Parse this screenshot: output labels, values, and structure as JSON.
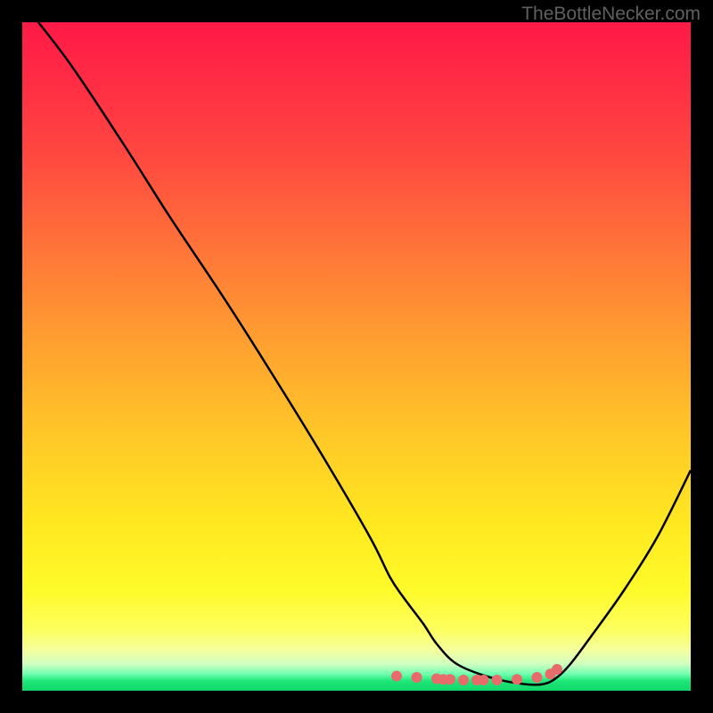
{
  "watermark": "TheBottleNecker.com",
  "chart_data": {
    "type": "line",
    "title": "",
    "xlabel": "",
    "ylabel": "",
    "xlim": [
      0,
      100
    ],
    "ylim": [
      0,
      100
    ],
    "series": [
      {
        "name": "bottleneck-curve",
        "x": [
          0,
          7,
          15,
          22,
          30,
          37,
          45,
          52,
          55,
          57,
          60,
          62,
          65,
          70,
          75,
          78,
          80,
          82,
          85,
          90,
          95,
          100
        ],
        "values": [
          103,
          94,
          82,
          71,
          59,
          48,
          35,
          23,
          17,
          14,
          10,
          7,
          4,
          2,
          1,
          1,
          2,
          4,
          8,
          15,
          23,
          33
        ]
      }
    ],
    "dots": {
      "name": "highlight-points",
      "x": [
        56,
        59,
        62,
        63,
        64,
        66,
        68,
        69,
        71,
        74,
        77,
        79,
        80
      ],
      "values": [
        2.2,
        2.0,
        1.8,
        1.7,
        1.7,
        1.6,
        1.6,
        1.6,
        1.6,
        1.7,
        2.0,
        2.5,
        3.2
      ]
    },
    "colors": {
      "curve": "#000000",
      "dots": "#e86b6b"
    }
  }
}
